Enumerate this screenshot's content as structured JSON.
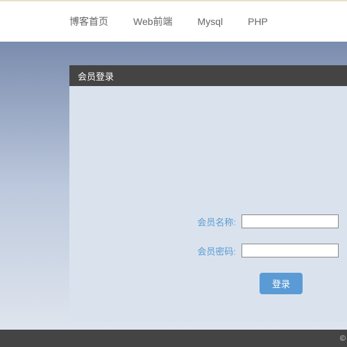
{
  "nav": {
    "items": [
      "博客首页",
      "Web前端",
      "Mysql",
      "PHP"
    ]
  },
  "panel": {
    "title": "会员登录"
  },
  "form": {
    "username_label": "会员名称:",
    "password_label": "会员密码:",
    "username_value": "",
    "password_value": "",
    "submit_label": "登录"
  },
  "footer": {
    "text": "©"
  }
}
